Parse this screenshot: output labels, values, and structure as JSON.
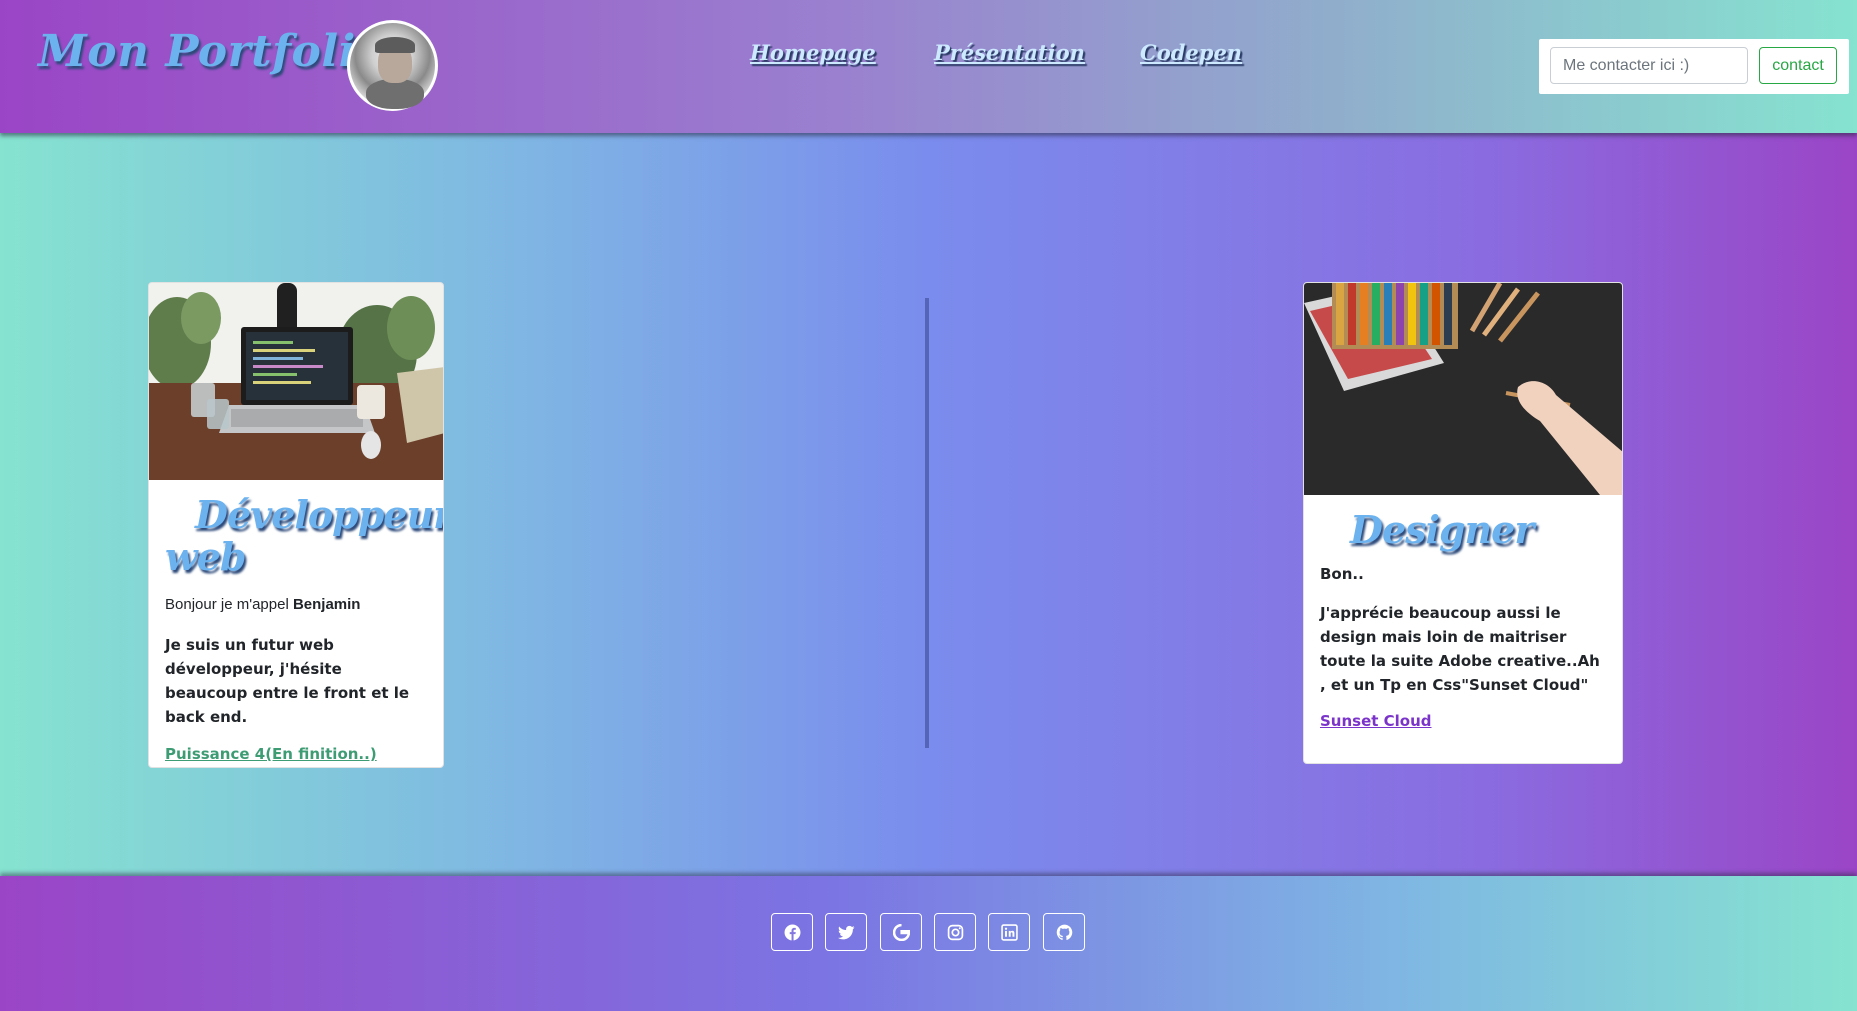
{
  "header": {
    "brand": "Mon Portfolio",
    "nav": [
      {
        "label": "Homepage"
      },
      {
        "label": "Présentation"
      },
      {
        "label": "Codepen"
      }
    ],
    "contact": {
      "placeholder": "Me contacter ici :)",
      "button_label": "contact"
    }
  },
  "cards": {
    "dev": {
      "title": "Développeur web",
      "intro_prefix": "Bonjour je m'appel ",
      "intro_name": "Benjamin",
      "body_prefix": "Je suis un futur ",
      "body_strong": "web développeur",
      "body_suffix": ", j'hésite beaucoup entre le front et le back end.",
      "link": "Puissance 4(En finition..)"
    },
    "designer": {
      "title": "Designer",
      "greeting": "Bon..",
      "body_prefix": "J'apprécie beaucoup aussi le design mais loin de maitriser toute la suite ",
      "body_strong": "Adobe creative",
      "body_suffix": "..Ah , et un Tp en Css\"Sunset Cloud\"",
      "link": "Sunset Cloud"
    }
  },
  "footer": {
    "social_icons": [
      "facebook-icon",
      "twitter-icon",
      "google-icon",
      "instagram-icon",
      "linkedin-icon",
      "github-icon"
    ]
  },
  "colors": {
    "accent_blue": "#6cb2ee",
    "link_green": "#3e9c74",
    "link_purple": "#7b34c9",
    "button_green": "#28a745"
  }
}
